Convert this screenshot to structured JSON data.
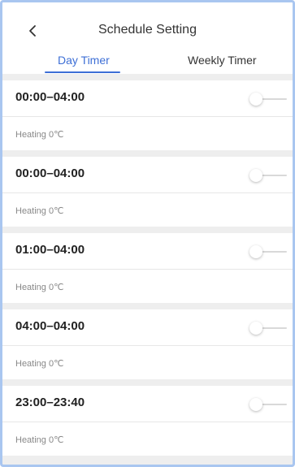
{
  "header": {
    "title": "Schedule Setting",
    "tabs": [
      {
        "label": "Day Timer",
        "active": true
      },
      {
        "label": "Weekly Timer",
        "active": false
      }
    ]
  },
  "colors": {
    "accent": "#3d6fd6",
    "background": "#eeeeee"
  },
  "schedules": [
    {
      "time": "00:00–04:00",
      "mode": "Heating 0℃",
      "enabled": false
    },
    {
      "time": "00:00–04:00",
      "mode": "Heating 0℃",
      "enabled": false
    },
    {
      "time": "01:00–04:00",
      "mode": "Heating 0℃",
      "enabled": false
    },
    {
      "time": "04:00–04:00",
      "mode": "Heating 0℃",
      "enabled": false
    },
    {
      "time": "23:00–23:40",
      "mode": "Heating 0℃",
      "enabled": false
    }
  ]
}
